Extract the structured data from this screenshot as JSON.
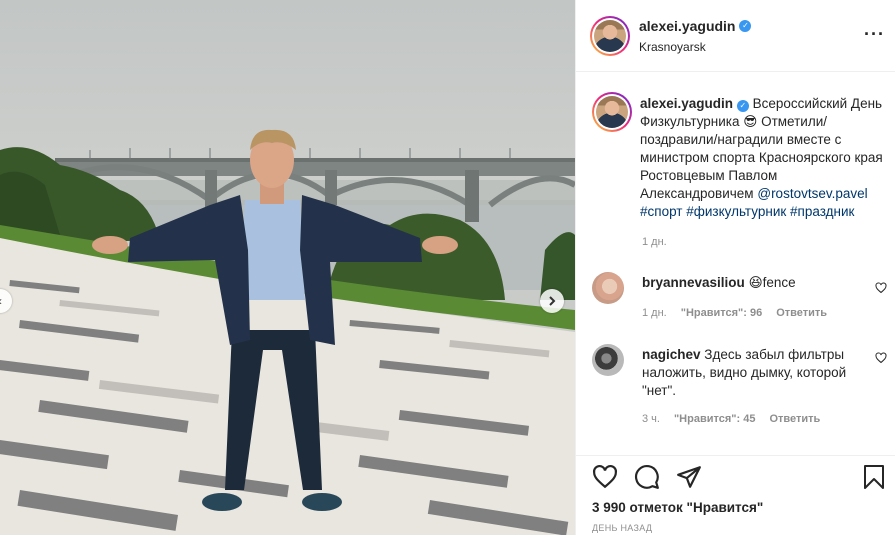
{
  "post": {
    "username": "alexei.yagudin",
    "location": "Krasnoyarsk",
    "caption_text": "Всероссийский День Физкультурника 😎 Отметили/поздравили/наградили вместе с министром спорта Красноярского края Ростовцевым Павлом Александровичем",
    "caption_mention": "@rostovtsev.pavel",
    "caption_tags": "#спорт #физкультурник #праздник",
    "time": "1 дн.",
    "likes": "3 990 отметок \"Нравится\"",
    "posted": "ДЕНЬ НАЗАД"
  },
  "comments": [
    {
      "username": "bryannevasiliou",
      "text": "😆fence",
      "time": "1 дн.",
      "likes": "\"Нравится\": 96",
      "reply": "Ответить"
    },
    {
      "username": "nagichev",
      "text": "Здесь забыл фильтры наложить, видно дымку, которой \"нет\".",
      "time": "3 ч.",
      "likes": "\"Нравится\": 45",
      "reply": "Ответить"
    }
  ],
  "icons": {
    "verified": "verified-badge-icon",
    "like": "heart-icon",
    "comment": "comment-icon",
    "share": "share-icon",
    "save": "bookmark-icon",
    "more": "more-options-icon",
    "next": "chevron-right-icon",
    "prev": "chevron-left-icon"
  },
  "colors": {
    "link": "#00376b",
    "verified": "#3897f0",
    "muted": "#8e8e8e"
  }
}
